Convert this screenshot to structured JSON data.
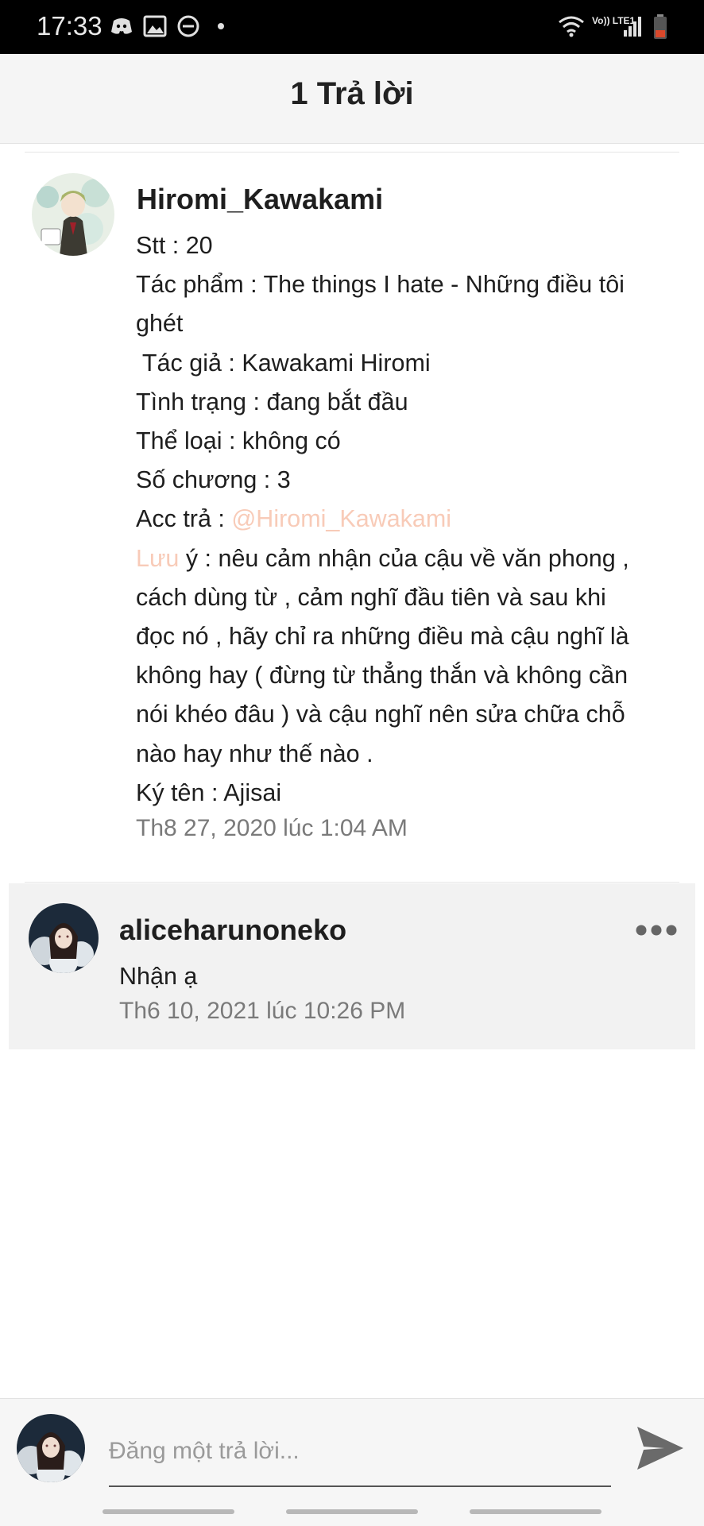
{
  "status_bar": {
    "time": "17:33",
    "network_label": "Vo)) LTE1",
    "icons": [
      "discord-icon",
      "image-icon",
      "dnd-icon",
      "dot-icon",
      "wifi-icon",
      "signal-icon",
      "battery-icon"
    ]
  },
  "header": {
    "title": "1 Trả lời"
  },
  "post": {
    "author": "Hiromi_Kawakami",
    "lines": [
      "Stt : 20",
      "Tác phẩm : The things I hate - Những điều tôi",
      "ghét",
      " Tác giả : Kawakami Hiromi",
      "Tình trạng : đang bắt đầu",
      "Thể loại : không có",
      "Số chương : 3"
    ],
    "acc_label": "Acc trả : ",
    "acc_mention": "@Hiromi_Kawakami",
    "note_highlight": "Lưu",
    "note_lines": [
      " ý : nêu cảm nhận của cậu về văn phong ,",
      "cách dùng từ , cảm nghĩ đầu tiên và sau khi",
      "đọc nó , hãy chỉ ra những điều mà cậu nghĩ là",
      "không hay ( đừng từ thẳng thắn và không cần",
      "nói khéo đâu ) và cậu nghĩ nên sửa chữa chỗ",
      "nào hay như thế nào ."
    ],
    "signature": "Ký tên : Ajisai",
    "timestamp": "Th8 27, 2020 lúc 1:04 AM"
  },
  "reply": {
    "author": "aliceharunoneko",
    "text": "Nhận ạ",
    "timestamp": "Th6 10, 2021 lúc 10:26 PM"
  },
  "composer": {
    "placeholder": "Đăng một trả lời..."
  },
  "colors": {
    "mention": "#f8cbb8",
    "reply_background": "#f2f2f2",
    "header_background": "#f5f5f5"
  }
}
